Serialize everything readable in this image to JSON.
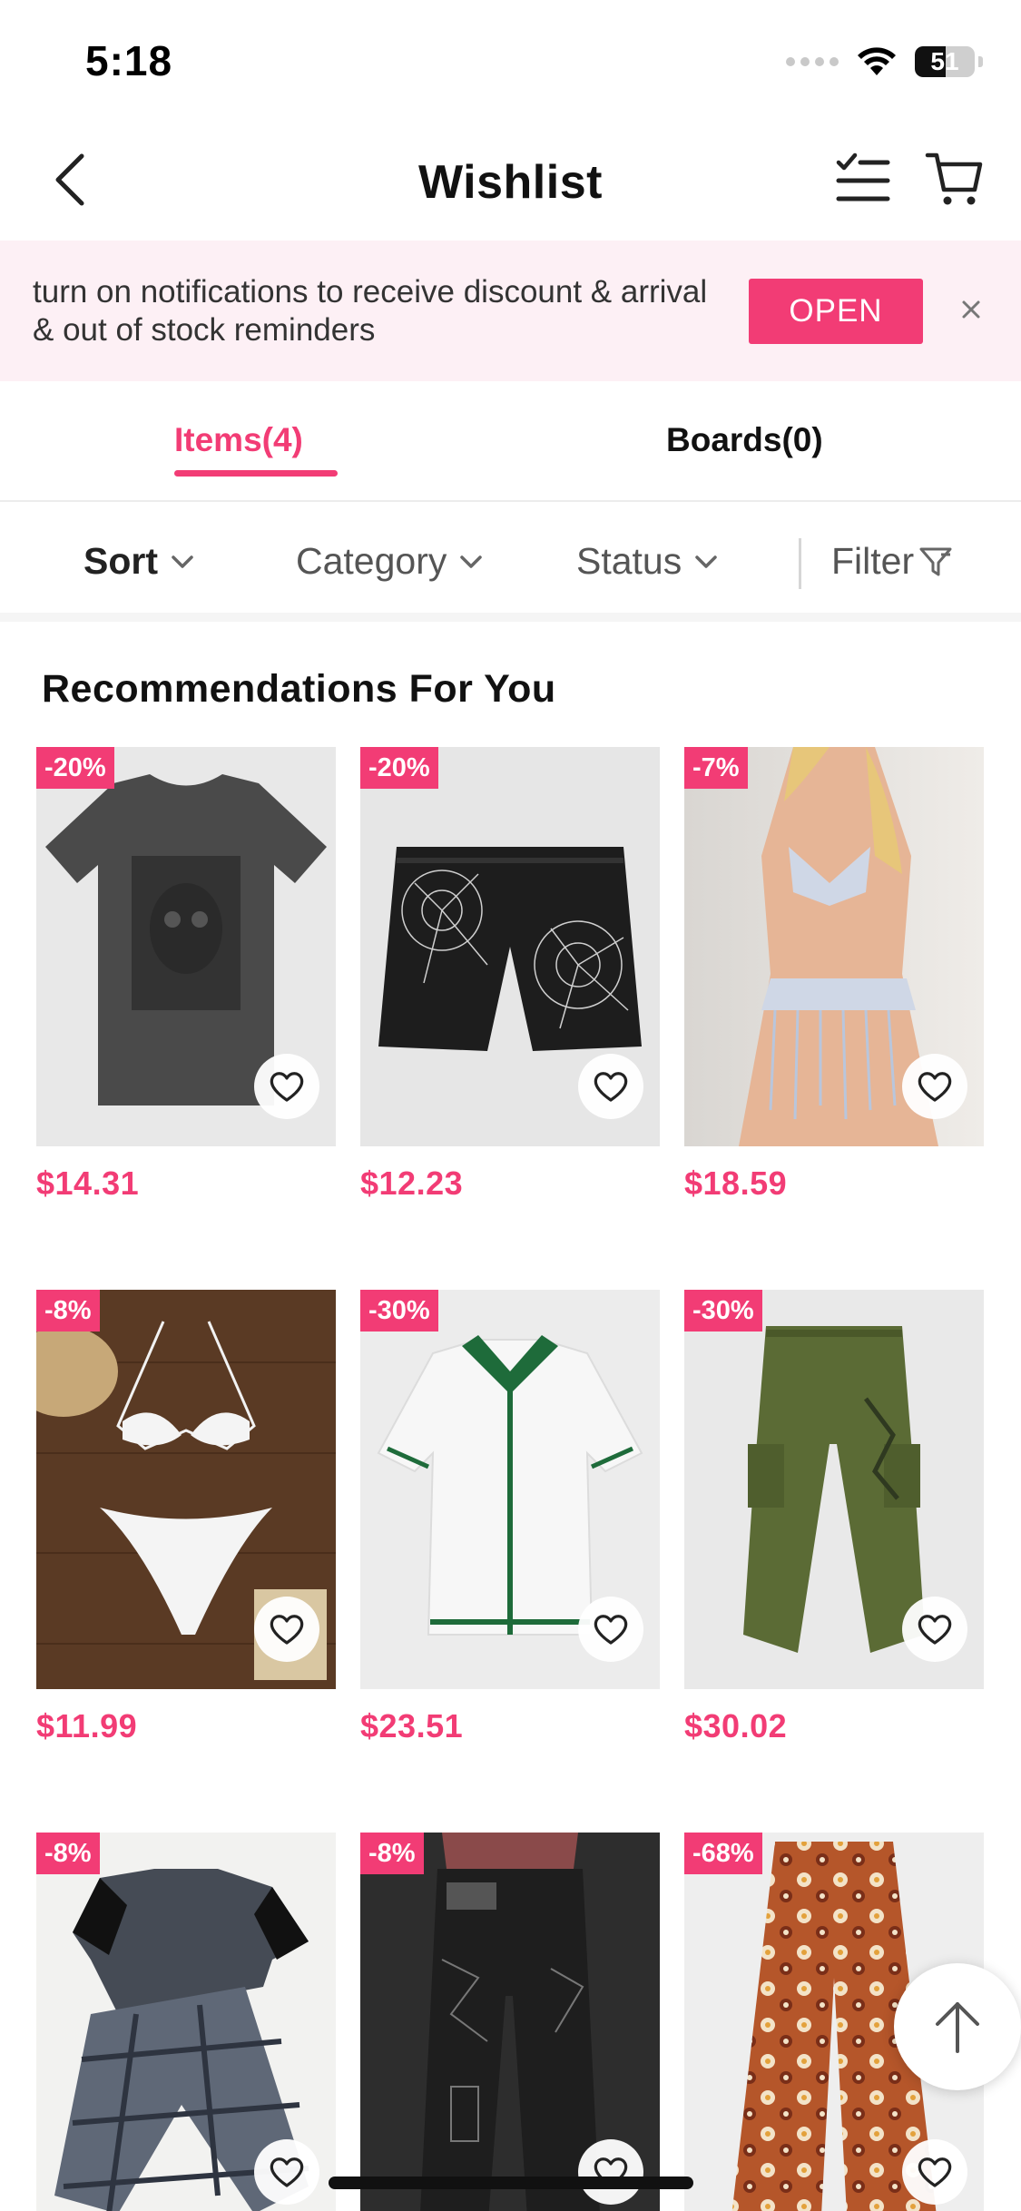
{
  "status_bar": {
    "time": "5:18",
    "battery": "51",
    "battery_level": 0.51
  },
  "header": {
    "title": "Wishlist",
    "back_icon": "chevron-left-icon",
    "edit_icon": "checklist-icon",
    "cart_icon": "cart-icon"
  },
  "notification": {
    "text": "turn on notifications to receive discount & arrival & out of stock reminders",
    "open_label": "OPEN",
    "close_icon": "close-icon"
  },
  "tabs": [
    {
      "label": "Items(4)",
      "active": true
    },
    {
      "label": "Boards(0)",
      "active": false
    }
  ],
  "filters": {
    "sort": "Sort",
    "category": "Category",
    "status": "Status",
    "filter": "Filter"
  },
  "recommendations": {
    "title": "Recommendations For You",
    "products": [
      {
        "discount": "-20%",
        "price": "$14.31",
        "image": "gray-graphic-tshirt"
      },
      {
        "discount": "-20%",
        "price": "$12.23",
        "image": "black-spiderweb-shorts"
      },
      {
        "discount": "-7%",
        "price": "$18.59",
        "image": "sequin-bikini-fringe-skirt"
      },
      {
        "discount": "-8%",
        "price": "$11.99",
        "image": "white-halter-bikini"
      },
      {
        "discount": "-30%",
        "price": "$23.51",
        "image": "white-knit-polo-green-trim"
      },
      {
        "discount": "-30%",
        "price": "$30.02",
        "image": "olive-cargo-joggers"
      },
      {
        "discount": "-8%",
        "price": "",
        "image": "plaid-pajama-set"
      },
      {
        "discount": "-8%",
        "price": "",
        "image": "black-graphic-jeans"
      },
      {
        "discount": "-68%",
        "price": "",
        "image": "floral-wide-leg-pants"
      }
    ]
  },
  "colors": {
    "accent": "#f23c75",
    "banner_bg": "#fdf0f5"
  }
}
